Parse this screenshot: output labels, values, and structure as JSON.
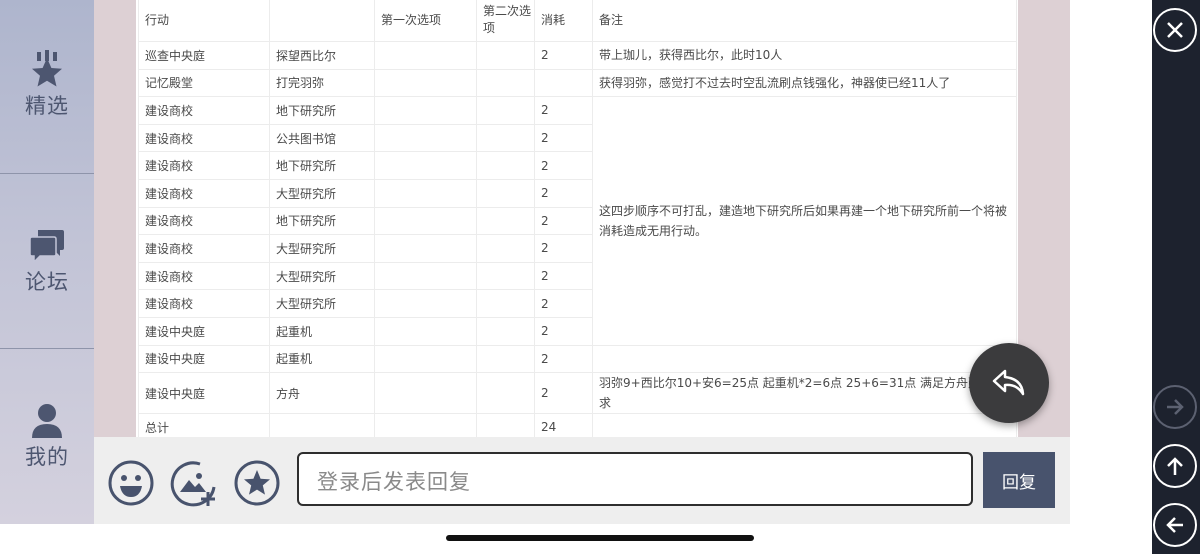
{
  "nav": {
    "items": [
      {
        "label": "精选",
        "icon": "featured-star-icon"
      },
      {
        "label": "论坛",
        "icon": "forum-chat-icon"
      },
      {
        "label": "我的",
        "icon": "user-profile-icon"
      }
    ]
  },
  "table": {
    "headers": [
      "行动",
      "",
      "第一次选项",
      "第二次选项",
      "消耗",
      "备注"
    ],
    "rows": [
      [
        "巡查中央庭",
        "探望西比尔",
        "",
        "",
        "2",
        "带上珈儿，获得西比尔，此时10人"
      ],
      [
        "记忆殿堂",
        "打完羽弥",
        "",
        "",
        "",
        "获得羽弥，感觉打不过去时空乱流刷点钱强化，神器使已经11人了"
      ],
      [
        "建设商校",
        "地下研究所",
        "",
        "",
        "2",
        ""
      ],
      [
        "建设商校",
        "公共图书馆",
        "",
        "",
        "2",
        ""
      ],
      [
        "建设商校",
        "地下研究所",
        "",
        "",
        "2",
        ""
      ],
      [
        "建设商校",
        "大型研究所",
        "",
        "",
        "2",
        ""
      ],
      [
        "建设商校",
        "地下研究所",
        "",
        "",
        "2",
        ""
      ],
      [
        "建设商校",
        "大型研究所",
        "",
        "",
        "2",
        ""
      ],
      [
        "建设商校",
        "大型研究所",
        "",
        "",
        "2",
        ""
      ],
      [
        "建设商校",
        "大型研究所",
        "",
        "",
        "2",
        ""
      ],
      [
        "建设中央庭",
        "起重机",
        "",
        "",
        "2",
        ""
      ],
      [
        "建设中央庭",
        "起重机",
        "",
        "",
        "2",
        ""
      ],
      [
        "建设中央庭",
        "方舟",
        "",
        "",
        "2",
        "羽弥9+西比尔10+安6=25点 起重机*2=6点 25+6=31点 满足方舟建造要求"
      ],
      [
        "总计",
        "",
        "",
        "",
        "24",
        ""
      ]
    ],
    "merged_note": "这四步顺序不可打乱，建造地下研究所后如果再建一个地下研究所前一个将被消耗造成无用行动。"
  },
  "reply": {
    "placeholder": "登录后发表回复",
    "send_label": "回复"
  },
  "icons": {
    "bottom": [
      "emoji-icon",
      "add-image-icon",
      "star-favorite-icon"
    ],
    "floating": "reply-arrow-icon",
    "right": [
      "close-icon",
      "forward-arrow-icon",
      "scroll-up-arrow-icon",
      "back-arrow-icon"
    ]
  },
  "colors": {
    "nav_text": "#4d5670",
    "send_button": "#48536d",
    "right_strip": "#1d222e",
    "fab": "#3b3b3d"
  }
}
